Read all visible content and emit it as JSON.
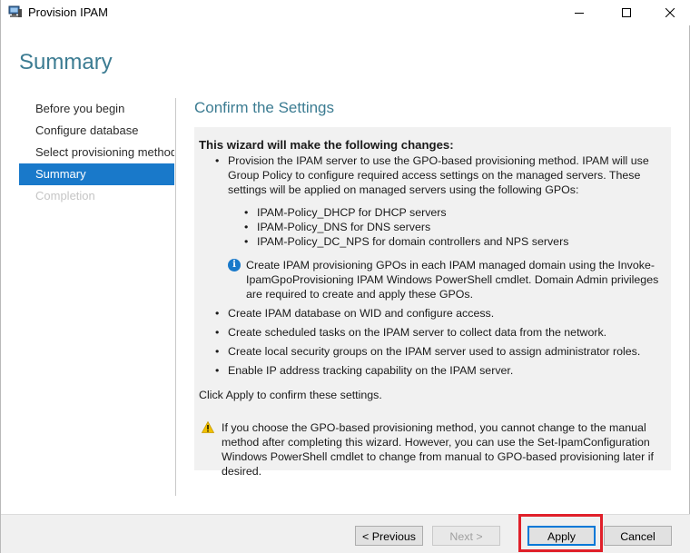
{
  "window": {
    "title": "Provision IPAM",
    "icon": "server-icon",
    "controls": {
      "minimize_icon": "minimize-icon",
      "maximize_icon": "maximize-icon",
      "close_icon": "close-icon"
    }
  },
  "header": {
    "title": "Summary"
  },
  "nav": {
    "items": [
      {
        "label": "Before you begin",
        "state": "normal"
      },
      {
        "label": "Configure database",
        "state": "normal"
      },
      {
        "label": "Select provisioning method",
        "state": "normal"
      },
      {
        "label": "Summary",
        "state": "active"
      },
      {
        "label": "Completion",
        "state": "disabled"
      }
    ]
  },
  "content": {
    "title": "Confirm the Settings",
    "heading": "This wizard will make the following changes:",
    "bullets": {
      "b1": "Provision the IPAM server to use the GPO-based provisioning method. IPAM will use Group Policy to configure required access settings on the managed servers. These settings will be applied on managed servers using the following GPOs:",
      "gpos": [
        "IPAM-Policy_DHCP for DHCP servers",
        "IPAM-Policy_DNS for DNS servers",
        "IPAM-Policy_DC_NPS for domain controllers and NPS servers"
      ],
      "info": "Create IPAM provisioning GPOs in each IPAM managed domain using the Invoke-IpamGpoProvisioning IPAM Windows PowerShell cmdlet. Domain Admin privileges are required to create and apply these GPOs.",
      "b2": "Create IPAM database on WID and configure access.",
      "b3": "Create scheduled tasks on the IPAM server to collect data from the network.",
      "b4": "Create local security groups on the IPAM server used to assign administrator roles.",
      "b5": "Enable IP address tracking capability on the IPAM server."
    },
    "click_apply": "Click Apply to confirm these settings.",
    "warning": "If you choose the GPO-based provisioning method, you cannot change to the manual method after completing this wizard. However, you can use the Set-IpamConfiguration Windows PowerShell cmdlet to change from manual to GPO-based provisioning later if desired."
  },
  "footer": {
    "previous_label": "< Previous",
    "next_label": "Next >",
    "apply_label": "Apply",
    "cancel_label": "Cancel"
  },
  "colors": {
    "accent_blue": "#1979ca",
    "title_teal": "#3c7c92",
    "highlight_red": "#e0202a",
    "warning_yellow": "#f2c100"
  }
}
